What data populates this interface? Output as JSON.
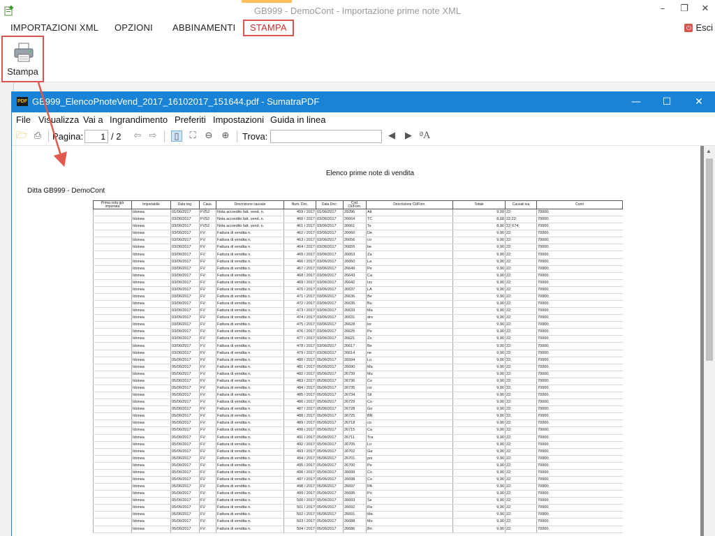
{
  "app": {
    "title": "GB999 - DemoCont - Importazione prime note XML",
    "tabs": [
      "IMPORTAZIONI XML",
      "OPZIONI",
      "ABBINAMENTI",
      "STAMPA"
    ],
    "exit_label": "Esci",
    "print_button_label": "Stampa",
    "accent_color": "#d9534f"
  },
  "pdf_window": {
    "title": "GB999_ElencoPnoteVend_2017_16102017_151644.pdf - SumatraPDF",
    "menu": [
      "File",
      "Visualizza",
      "Vai a",
      "Ingrandimento",
      "Preferiti",
      "Impostazioni",
      "Guida in linea"
    ],
    "toolbar": {
      "page_label": "Pagina:",
      "page_value": "1",
      "page_total": "/ 2",
      "find_label": "Trova:"
    },
    "titlebar_color": "#1883d7"
  },
  "document": {
    "title": "Elenco prime note di vendita",
    "company": "Ditta GB999 - DemoCont",
    "columns": [
      "Prima nota già importata",
      "Importabile",
      "Data reg.",
      "Caus.",
      "Descrizione causale",
      "Num. Doc.",
      "Data Doc.",
      "Cod. Cli/Forn.",
      "Descrizione Cli/Forn.",
      "Totale",
      "Causali iva",
      "Conti"
    ],
    "rows": [
      [
        "",
        "Idonea",
        "01/06/2017",
        "FV52",
        "Nota accredito fatt. vend. n.",
        "459 / 2017",
        "01/06/2017",
        "29296",
        "Alt",
        "9,00",
        "22;",
        "70000;"
      ],
      [
        "",
        "Idonea",
        "03/06/2017",
        "FV52",
        "Nota accredito fatt. vend. n.",
        "460 / 2017",
        "03/06/2017",
        "26664",
        "TC",
        "8,68",
        "22;22;",
        "70000;"
      ],
      [
        "",
        "Idonea",
        "03/06/2017",
        "FV52",
        "Nota accredito fatt. vend. n.",
        "461 / 2017",
        "03/06/2017",
        "26661",
        "Te",
        "8,90",
        "22;X74;",
        "70000;"
      ],
      [
        "",
        "Idonea",
        "03/06/2017",
        "FV",
        "Fattura di vendita n.",
        "462 / 2017",
        "03/06/2017",
        "26660",
        "De",
        "9,90",
        "22;",
        "70000;"
      ],
      [
        "",
        "Idonea",
        "03/06/2017",
        "FV",
        "Fattura di vendita n.",
        "463 / 2017",
        "03/06/2017",
        "26656",
        "co",
        "9,90",
        "22;",
        "70000;"
      ],
      [
        "",
        "Idonea",
        "03/06/2017",
        "FV",
        "Fattura di vendita n.",
        "464 / 2017",
        "03/06/2017",
        "26655",
        "be",
        "9,90",
        "22;",
        "70000;"
      ],
      [
        "",
        "Idonea",
        "03/06/2017",
        "FV",
        "Fattura di vendita n.",
        "465 / 2017",
        "03/06/2017",
        "26653",
        "Za",
        "9,90",
        "22;",
        "70000;"
      ],
      [
        "",
        "Idonea",
        "03/06/2017",
        "FV",
        "Fattura di vendita n.",
        "466 / 2017",
        "03/06/2017",
        "26650",
        "La",
        "9,90",
        "22;",
        "70000;"
      ],
      [
        "",
        "Idonea",
        "03/06/2017",
        "FV",
        "Fattura di vendita n.",
        "467 / 2017",
        "03/06/2017",
        "26649",
        "Pe",
        "9,90",
        "22;",
        "70000;"
      ],
      [
        "",
        "Idonea",
        "03/06/2017",
        "FV",
        "Fattura di vendita n.",
        "468 / 2017",
        "03/06/2017",
        "26643",
        "Ca",
        "9,90",
        "22;",
        "70000;"
      ],
      [
        "",
        "Idonea",
        "03/06/2017",
        "FV",
        "Fattura di vendita n.",
        "469 / 2017",
        "03/06/2017",
        "26642",
        "Izz",
        "9,90",
        "22;",
        "70000;"
      ],
      [
        "",
        "Idonea",
        "03/06/2017",
        "FV",
        "Fattura di vendita n.",
        "470 / 2017",
        "03/06/2017",
        "26637",
        "LA",
        "9,90",
        "22;",
        "70000;"
      ],
      [
        "",
        "Idonea",
        "03/06/2017",
        "FV",
        "Fattura di vendita n.",
        "471 / 2017",
        "03/06/2017",
        "26636",
        "Be",
        "9,90",
        "22;",
        "70000;"
      ],
      [
        "",
        "Idonea",
        "03/06/2017",
        "FV",
        "Fattura di vendita n.",
        "472 / 2017",
        "03/06/2017",
        "26635",
        "Bu",
        "9,90",
        "22;",
        "70000;"
      ],
      [
        "",
        "Idonea",
        "03/06/2017",
        "FV",
        "Fattura di vendita n.",
        "473 / 2017",
        "03/06/2017",
        "26633",
        "Ma",
        "9,90",
        "22;",
        "70000;"
      ],
      [
        "",
        "Idonea",
        "03/06/2017",
        "FV",
        "Fattura di vendita n.",
        "474 / 2017",
        "03/06/2017",
        "26631",
        "dro",
        "9,90",
        "22;",
        "70000;"
      ],
      [
        "",
        "Idonea",
        "03/06/2017",
        "FV",
        "Fattura di vendita n.",
        "475 / 2017",
        "03/06/2017",
        "26628",
        "lor",
        "9,90",
        "22;",
        "70000;"
      ],
      [
        "",
        "Idonea",
        "03/06/2017",
        "FV",
        "Fattura di vendita n.",
        "476 / 2017",
        "03/06/2017",
        "26625",
        "Pe",
        "9,90",
        "22;",
        "70000;"
      ],
      [
        "",
        "Idonea",
        "03/06/2017",
        "FV",
        "Fattura di vendita n.",
        "477 / 2017",
        "03/06/2017",
        "26621",
        "Zo",
        "9,90",
        "22;",
        "70000;"
      ],
      [
        "",
        "Idonea",
        "03/06/2017",
        "FV",
        "Fattura di vendita n.",
        "478 / 2017",
        "03/06/2017",
        "26617",
        "Be",
        "9,90",
        "22;",
        "70000;"
      ],
      [
        "",
        "Idonea",
        "03/06/2017",
        "FV",
        "Fattura di vendita n.",
        "479 / 2017",
        "03/06/2017",
        "26614",
        "ne",
        "9,90",
        "22;",
        "70000;"
      ],
      [
        "",
        "Idonea",
        "05/06/2017",
        "FV",
        "Fattura di vendita n.",
        "480 / 2017",
        "05/06/2017",
        "26594",
        "Lo",
        "9,00",
        "22;",
        "70000;"
      ],
      [
        "",
        "Idonea",
        "05/06/2017",
        "FV",
        "Fattura di vendita n.",
        "481 / 2017",
        "05/06/2017",
        "26690",
        "Ma",
        "9,90",
        "22;",
        "70000;"
      ],
      [
        "",
        "Idonea",
        "05/06/2017",
        "FV",
        "Fattura di vendita n.",
        "482 / 2017",
        "05/06/2017",
        "26739",
        "Mu",
        "9,90",
        "22;",
        "70000;"
      ],
      [
        "",
        "Idonea",
        "05/06/2017",
        "FV",
        "Fattura di vendita n.",
        "483 / 2017",
        "05/06/2017",
        "26736",
        "Ce",
        "9,90",
        "22;",
        "70000;"
      ],
      [
        "",
        "Idonea",
        "05/06/2017",
        "FV",
        "Fattura di vendita n.",
        "484 / 2017",
        "05/06/2017",
        "26735",
        "ror",
        "9,90",
        "22;",
        "70000;"
      ],
      [
        "",
        "Idonea",
        "05/06/2017",
        "FV",
        "Fattura di vendita n.",
        "485 / 2017",
        "05/06/2017",
        "26734",
        "Sil",
        "9,90",
        "22;",
        "70000;"
      ],
      [
        "",
        "Idonea",
        "05/06/2017",
        "FV",
        "Fattura di vendita n.",
        "486 / 2017",
        "05/06/2017",
        "26729",
        "Co",
        "9,90",
        "22;",
        "70000;"
      ],
      [
        "",
        "Idonea",
        "05/06/2017",
        "FV",
        "Fattura di vendita n.",
        "487 / 2017",
        "05/06/2017",
        "26728",
        "Go",
        "9,90",
        "22;",
        "70000;"
      ],
      [
        "",
        "Idonea",
        "05/06/2017",
        "FV",
        "Fattura di vendita n.",
        "488 / 2017",
        "05/06/2017",
        "26725",
        "BR",
        "9,90",
        "22;",
        "70000;"
      ],
      [
        "",
        "Idonea",
        "05/06/2017",
        "FV",
        "Fattura di vendita n.",
        "489 / 2017",
        "05/06/2017",
        "26718",
        "co",
        "9,90",
        "22;",
        "70000;"
      ],
      [
        "",
        "Idonea",
        "05/06/2017",
        "FV",
        "Fattura di vendita n.",
        "490 / 2017",
        "05/06/2017",
        "26715",
        "Ca",
        "9,90",
        "22;",
        "70000;"
      ],
      [
        "",
        "Idonea",
        "05/06/2017",
        "FV",
        "Fattura di vendita n.",
        "491 / 2017",
        "05/06/2017",
        "26711",
        "Tra",
        "9,90",
        "22;",
        "70000;"
      ],
      [
        "",
        "Idonea",
        "05/06/2017",
        "FV",
        "Fattura di vendita n.",
        "492 / 2017",
        "05/06/2017",
        "26705",
        "Lo",
        "9,90",
        "22;",
        "70000;"
      ],
      [
        "",
        "Idonea",
        "05/06/2017",
        "FV",
        "Fattura di vendita n.",
        "493 / 2017",
        "05/06/2017",
        "26702",
        "Ga",
        "9,90",
        "22;",
        "70000;"
      ],
      [
        "",
        "Idonea",
        "05/06/2017",
        "FV",
        "Fattura di vendita n.",
        "494 / 2017",
        "05/06/2017",
        "26701",
        "poi",
        "9,90",
        "22;",
        "70000;"
      ],
      [
        "",
        "Idonea",
        "05/06/2017",
        "FV",
        "Fattura di vendita n.",
        "495 / 2017",
        "05/06/2017",
        "26700",
        "Pe",
        "9,90",
        "22;",
        "70000;"
      ],
      [
        "",
        "Idonea",
        "05/06/2017",
        "FV",
        "Fattura di vendita n.",
        "496 / 2017",
        "05/06/2017",
        "26699",
        "Co",
        "9,90",
        "22;",
        "70000;"
      ],
      [
        "",
        "Idonea",
        "05/06/2017",
        "FV",
        "Fattura di vendita n.",
        "497 / 2017",
        "05/06/2017",
        "26698",
        "Co",
        "9,90",
        "22;",
        "70000;"
      ],
      [
        "",
        "Idonea",
        "05/06/2017",
        "FV",
        "Fattura di vendita n.",
        "498 / 2017",
        "05/06/2017",
        "26697",
        "PA",
        "9,90",
        "22;",
        "70000;"
      ],
      [
        "",
        "Idonea",
        "05/06/2017",
        "FV",
        "Fattura di vendita n.",
        "499 / 2017",
        "05/06/2017",
        "26695",
        "Pri",
        "9,90",
        "22;",
        "70000;"
      ],
      [
        "",
        "Idonea",
        "05/06/2017",
        "FV",
        "Fattura di vendita n.",
        "500 / 2017",
        "05/06/2017",
        "26693",
        "Se",
        "9,90",
        "22;",
        "70000;"
      ],
      [
        "",
        "Idonea",
        "05/06/2017",
        "FV",
        "Fattura di vendita n.",
        "501 / 2017",
        "05/06/2017",
        "26692",
        "Ra",
        "9,90",
        "22;",
        "70000;"
      ],
      [
        "",
        "Idonea",
        "05/06/2017",
        "FV",
        "Fattura di vendita n.",
        "502 / 2017",
        "05/06/2017",
        "26691",
        "Ma",
        "9,90",
        "22;",
        "70000;"
      ],
      [
        "",
        "Idonea",
        "05/06/2017",
        "FV",
        "Fattura di vendita n.",
        "503 / 2017",
        "05/06/2017",
        "26688",
        "Mo",
        "9,90",
        "22;",
        "70000;"
      ],
      [
        "",
        "Idonea",
        "05/06/2017",
        "FV",
        "Fattura di vendita n.",
        "504 / 2017",
        "05/06/2017",
        "26686",
        "Bri",
        "9,90",
        "22;",
        "70000;"
      ]
    ]
  }
}
